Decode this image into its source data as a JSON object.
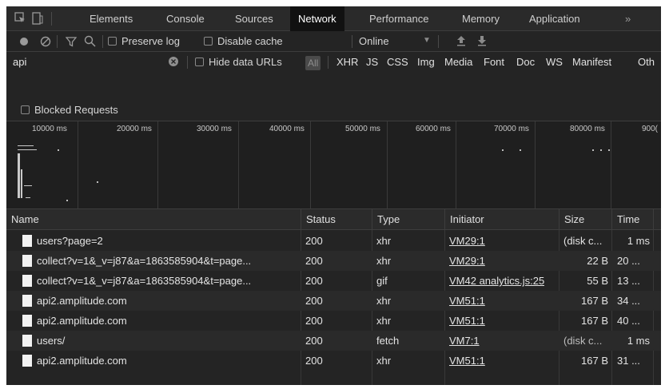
{
  "tabs": [
    "Elements",
    "Console",
    "Sources",
    "Network",
    "Performance",
    "Memory",
    "Application"
  ],
  "tabs_more": "»",
  "toolbar": {
    "preserve_log": "Preserve log",
    "disable_cache": "Disable cache",
    "throttle": "Online"
  },
  "filter": {
    "value": "api",
    "hide_data_urls": "Hide data URLs",
    "all": "All",
    "types": [
      "XHR",
      "JS",
      "CSS",
      "Img",
      "Media",
      "Font",
      "Doc",
      "WS",
      "Manifest",
      "Oth"
    ]
  },
  "blocked_requests": "Blocked Requests",
  "timeline": {
    "ticks": [
      "10000 ms",
      "20000 ms",
      "30000 ms",
      "40000 ms",
      "50000 ms",
      "60000 ms",
      "70000 ms",
      "80000 ms",
      "900("
    ]
  },
  "columns": [
    "Name",
    "Status",
    "Type",
    "Initiator",
    "Size",
    "Time"
  ],
  "rows": [
    {
      "name": "users?page=2",
      "status": "200",
      "type": "xhr",
      "initiator": "VM29:1",
      "size": "(disk c...",
      "time": "1 ms"
    },
    {
      "name": "collect?v=1&_v=j87&a=1863585904&t=page...",
      "status": "200",
      "type": "xhr",
      "initiator": "VM29:1",
      "size": "22 B",
      "time": "20 ..."
    },
    {
      "name": "collect?v=1&_v=j87&a=1863585904&t=page...",
      "status": "200",
      "type": "gif",
      "initiator": "VM42 analytics.js:25",
      "size": "55 B",
      "time": "13 ..."
    },
    {
      "name": "api2.amplitude.com",
      "status": "200",
      "type": "xhr",
      "initiator": "VM51:1",
      "size": "167 B",
      "time": "34 ..."
    },
    {
      "name": "api2.amplitude.com",
      "status": "200",
      "type": "xhr",
      "initiator": "VM51:1",
      "size": "167 B",
      "time": "40 ..."
    },
    {
      "name": "users/",
      "status": "200",
      "type": "fetch",
      "initiator": "VM7:1",
      "size": "(disk c...",
      "time": "1 ms"
    },
    {
      "name": "api2.amplitude.com",
      "status": "200",
      "type": "xhr",
      "initiator": "VM51:1",
      "size": "167 B",
      "time": "31 ..."
    }
  ],
  "colors": {
    "background": "#242424",
    "active_tab": "#111111",
    "text": "#d5d5d5"
  }
}
